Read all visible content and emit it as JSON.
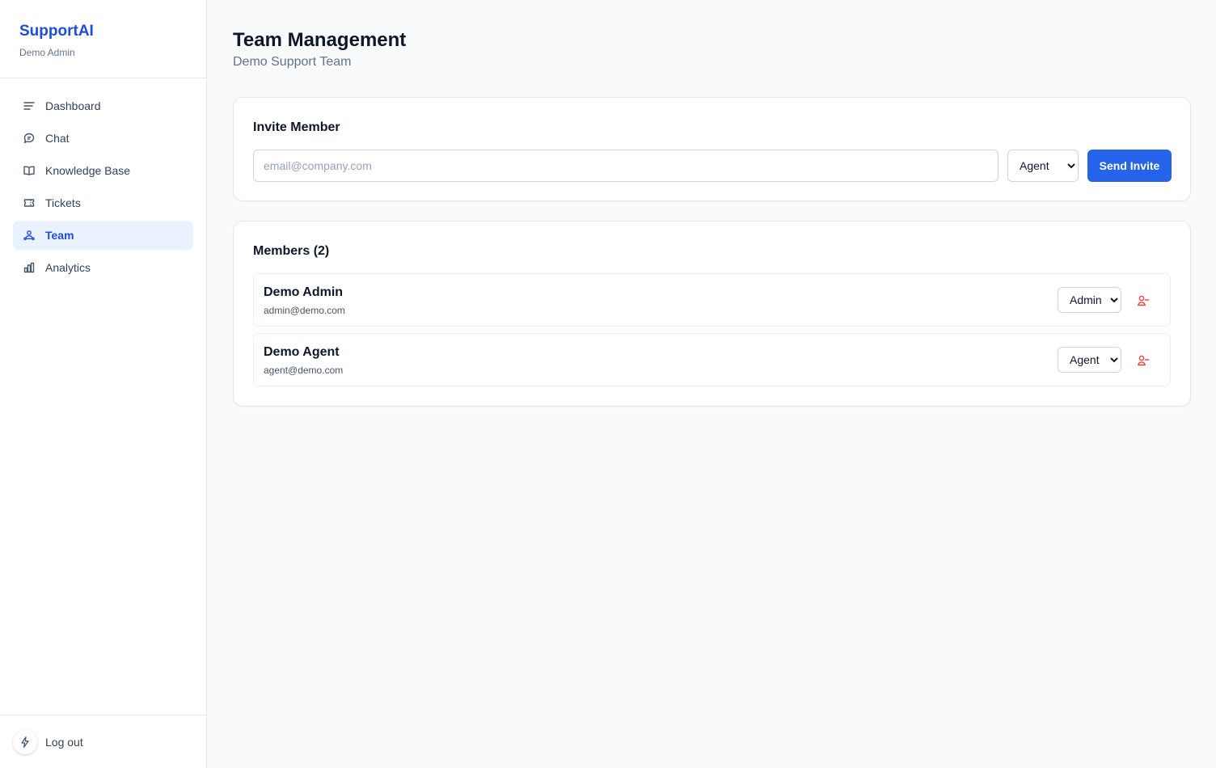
{
  "app": {
    "name": "SupportAI",
    "user": "Demo Admin"
  },
  "nav": {
    "items": [
      {
        "label": "Dashboard",
        "icon": "menu-lines-icon",
        "active": false
      },
      {
        "label": "Chat",
        "icon": "chat-bubble-icon",
        "active": false
      },
      {
        "label": "Knowledge Base",
        "icon": "book-open-icon",
        "active": false
      },
      {
        "label": "Tickets",
        "icon": "ticket-icon",
        "active": false
      },
      {
        "label": "Team",
        "icon": "team-icon",
        "active": true
      },
      {
        "label": "Analytics",
        "icon": "bar-chart-icon",
        "active": false
      }
    ],
    "logout_label": "Log out"
  },
  "page": {
    "title": "Team Management",
    "subtitle": "Demo Support Team"
  },
  "invite": {
    "title": "Invite Member",
    "email_placeholder": "email@company.com",
    "email_value": "",
    "role_selected": "Agent",
    "send_label": "Send Invite"
  },
  "members": {
    "title": "Members (2)",
    "list": [
      {
        "name": "Demo Admin",
        "email": "admin@demo.com",
        "role": "Admin"
      },
      {
        "name": "Demo Agent",
        "email": "agent@demo.com",
        "role": "Agent"
      }
    ]
  },
  "colors": {
    "accent": "#2563eb",
    "brand": "#1d4ed8",
    "active_bg": "#eaf2ff",
    "danger": "#ef4444"
  }
}
